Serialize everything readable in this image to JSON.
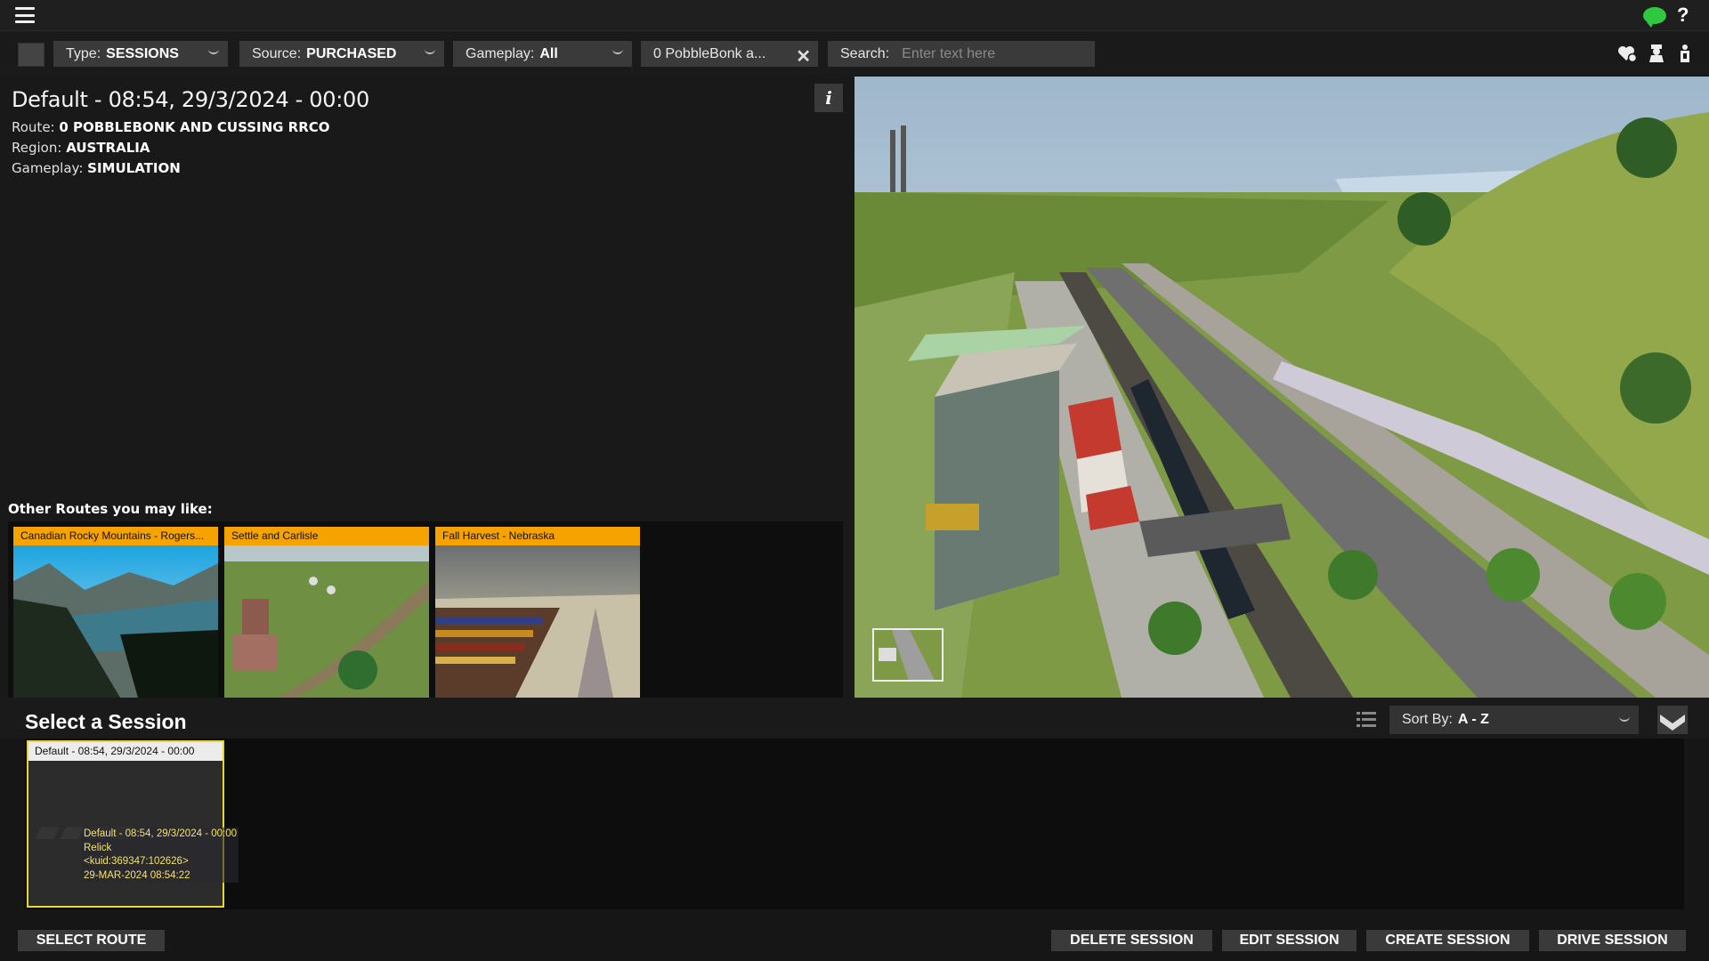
{
  "topbar": {
    "menu_icon": "hamburger-menu-icon",
    "chat_icon": "chat-bubble-icon",
    "help_label": "?"
  },
  "filters": {
    "type_label": "Type:",
    "type_value": "SESSIONS",
    "source_label": "Source:",
    "source_value": "PURCHASED",
    "gameplay_label": "Gameplay:",
    "gameplay_value": "All",
    "route_filter": "0 PobbleBonk a...",
    "search_label": "Search:",
    "search_placeholder": "Enter text here"
  },
  "toolbar_icons": [
    "favorite-icon",
    "driver-icon",
    "content-icon"
  ],
  "session_detail": {
    "title": "Default - 08:54, 29/3/2024 - 00:00",
    "route_label": "Route:",
    "route_value": "0 POBBLEBONK AND CUSSING RRCO",
    "region_label": "Region:",
    "region_value": "AUSTRALIA",
    "gameplay_label": "Gameplay:",
    "gameplay_value": "SIMULATION",
    "info_label": "i"
  },
  "other_routes": {
    "title": "Other Routes you may like:",
    "items": [
      {
        "label": "Canadian Rocky Mountains - Rogers..."
      },
      {
        "label": "Settle and Carlisle"
      },
      {
        "label": "Fall Harvest - Nebraska"
      }
    ]
  },
  "sessions": {
    "title": "Select a Session",
    "sort_label": "Sort By:",
    "sort_value": "A - Z",
    "items": [
      {
        "label": "Default - 08:54, 29/3/2024 - 00:00",
        "tooltip": [
          "Default - 08:54, 29/3/2024 - 00:00",
          "Relick",
          "<kuid:369347:102626>",
          "29-MAR-2024 08:54:22"
        ]
      }
    ]
  },
  "actions": {
    "select_route": "SELECT ROUTE",
    "delete_session": "DELETE SESSION",
    "edit_session": "EDIT SESSION",
    "create_session": "CREATE SESSION",
    "drive_session": "DRIVE SESSION"
  },
  "colors": {
    "accent_orange": "#f6a200",
    "selected_yellow": "#e8d633",
    "chat_green": "#2ec93f"
  }
}
